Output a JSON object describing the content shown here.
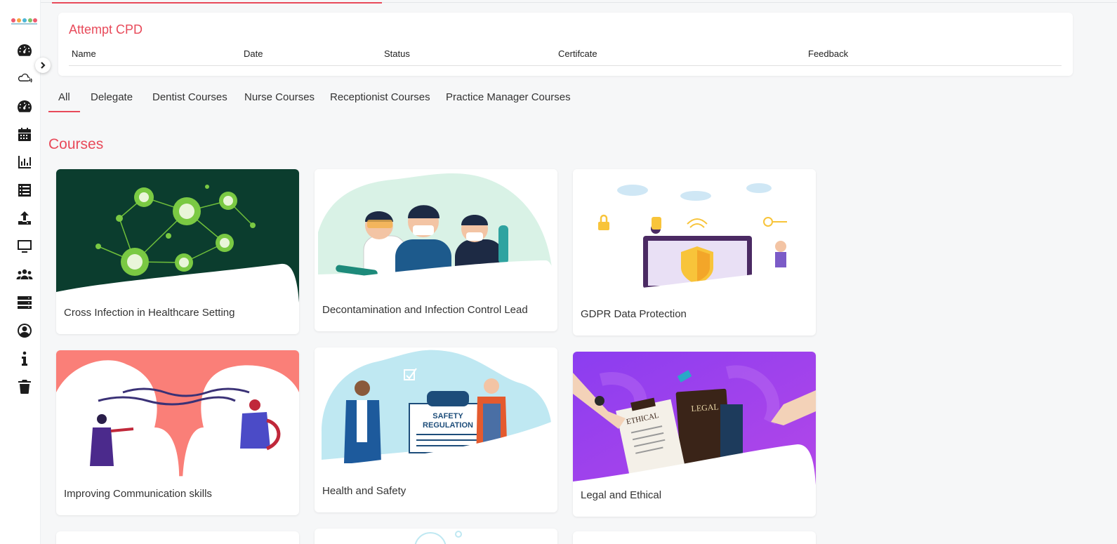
{
  "sidebar": {
    "logo_colors": [
      "#ef5a6f",
      "#f7a441",
      "#4cb7d6",
      "#7dc36b",
      "#ef5a6f"
    ],
    "icons": [
      "dashboard-icon",
      "cloud-broadcast-icon",
      "dashboard-icon",
      "calendar-icon",
      "bar-chart-icon",
      "list-icon",
      "upload-icon",
      "monitor-icon",
      "users-icon",
      "server-icon",
      "user-circle-icon",
      "info-icon",
      "trash-icon"
    ],
    "collapse_icon": "chevron-right-icon"
  },
  "cpd": {
    "title": "Attempt CPD",
    "columns": [
      "Name",
      "Date",
      "Status",
      "Certifcate",
      "Feedback"
    ]
  },
  "tabs": [
    "All",
    "Delegate",
    "Dentist Courses",
    "Nurse Courses",
    "Receptionist Courses",
    "Practice Manager Courses"
  ],
  "active_tab": "All",
  "courses_title": "Courses",
  "courses": [
    {
      "title": "Cross Infection in Healthcare Setting"
    },
    {
      "title": "Decontamination and Infection Control Lead"
    },
    {
      "title": "GDPR Data Protection"
    },
    {
      "title": "Improving Communication skills"
    },
    {
      "title": "Health and Safety",
      "art_text": [
        "SAFETY",
        "REGULATION"
      ]
    },
    {
      "title": "Legal and Ethical",
      "art_text": [
        "ETHICAL",
        "LEGAL"
      ]
    }
  ],
  "colors": {
    "accent": "#e84a5a",
    "dark_green": "#0b3d2e",
    "virus_green": "#7ac943",
    "coral": "#fa7f78",
    "purple": "#a742f0"
  }
}
